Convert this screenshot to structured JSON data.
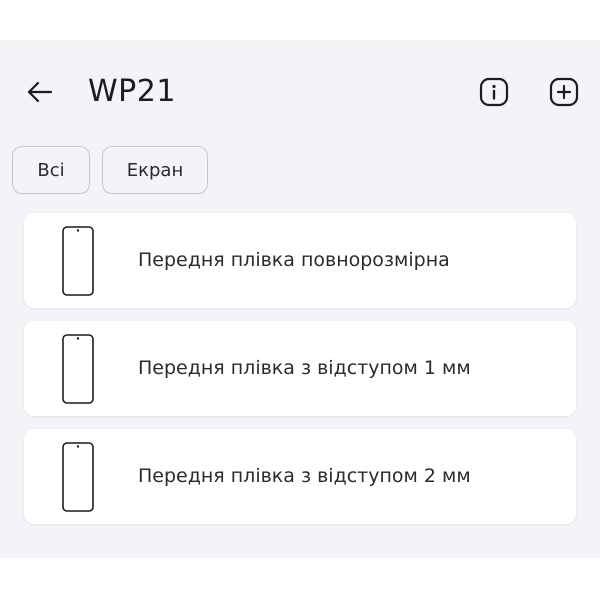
{
  "header": {
    "title": "WP21",
    "icons": {
      "back": "arrow-left-icon",
      "info": "info-icon",
      "add": "add-icon"
    }
  },
  "filters": [
    {
      "label": "Всі"
    },
    {
      "label": "Екран"
    }
  ],
  "items": [
    {
      "label": "Передня плівка повнорозмірна",
      "icon": "phone-outline-icon"
    },
    {
      "label": "Передня плівка з відступом 1 мм",
      "icon": "phone-outline-icon"
    },
    {
      "label": "Передня плівка з відступом 2 мм",
      "icon": "phone-outline-icon"
    }
  ],
  "colors": {
    "background": "#f4f3f8",
    "card": "#ffffff",
    "text": "#1c1b1f",
    "chip_border": "#c8c6cc"
  }
}
